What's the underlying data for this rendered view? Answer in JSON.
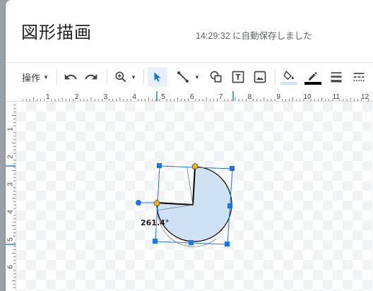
{
  "header": {
    "title": "図形描画",
    "autosave_status": "14:29:32 に自動保存しました"
  },
  "toolbar": {
    "actions_label": "操作",
    "tools": [
      {
        "name": "undo",
        "icon": "undo-icon"
      },
      {
        "name": "redo",
        "icon": "redo-icon"
      },
      {
        "name": "zoom",
        "icon": "zoom-icon"
      },
      {
        "name": "select",
        "icon": "cursor-icon",
        "selected": true
      },
      {
        "name": "line",
        "icon": "line-icon"
      },
      {
        "name": "shape",
        "icon": "shape-icon"
      },
      {
        "name": "text-box",
        "icon": "text-box-icon"
      },
      {
        "name": "image",
        "icon": "image-icon"
      },
      {
        "name": "fill-color",
        "icon": "paint-bucket-icon",
        "color": "#cfe2f3"
      },
      {
        "name": "border-color",
        "icon": "pencil-icon",
        "color": "#000000"
      },
      {
        "name": "border-weight",
        "icon": "line-weight-icon"
      },
      {
        "name": "border-dash",
        "icon": "line-dash-icon"
      }
    ]
  },
  "ruler": {
    "horizontal_numbers": [
      "1",
      "2",
      "3",
      "4",
      "5",
      "6",
      "7",
      "8",
      "9",
      "10",
      "11",
      "12"
    ],
    "vertical_numbers": [
      "1",
      "2",
      "3",
      "4",
      "5",
      "6"
    ],
    "accent_color": "#1a73e8"
  },
  "shape": {
    "type": "pie",
    "fill_color": "#cfe2f3",
    "border_color": "#000000",
    "handle_color": "#1a73e8",
    "adjust_handle_color": "#f4b400",
    "angle_label": "261.4°"
  }
}
